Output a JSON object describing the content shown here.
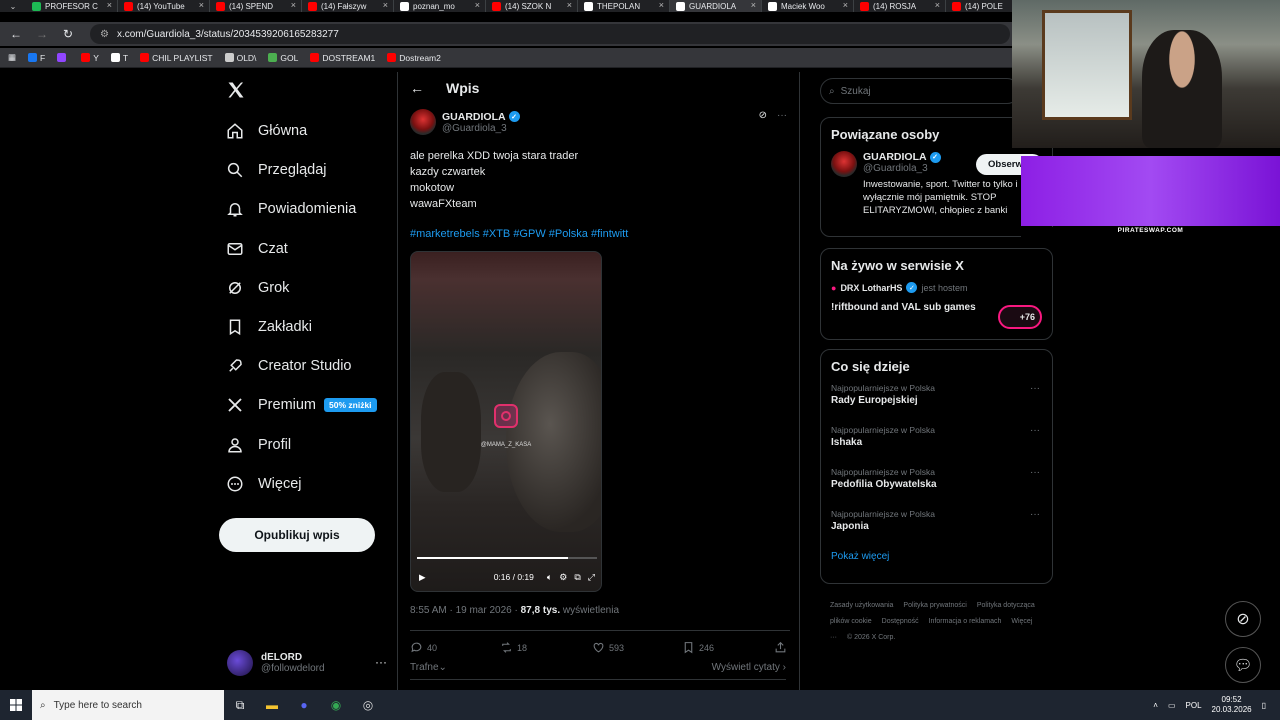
{
  "browser": {
    "tabs": [
      {
        "label": "PROFESOR C",
        "color": "#1db954"
      },
      {
        "label": "(14) YouTube",
        "color": "#ff0000"
      },
      {
        "label": "(14) SPEND",
        "color": "#ff0000"
      },
      {
        "label": "(14) Fałszyw",
        "color": "#ff0000"
      },
      {
        "label": "poznan_mo",
        "color": "#ffffff"
      },
      {
        "label": "(14) SZOK N",
        "color": "#ff0000"
      },
      {
        "label": "THEPOLAN",
        "color": "#ffffff"
      },
      {
        "label": "GUARDIOLA",
        "color": "#ffffff",
        "active": true
      },
      {
        "label": "Maciek Woo",
        "color": "#ffffff"
      },
      {
        "label": "(14) ROSJA",
        "color": "#ff0000"
      },
      {
        "label": "(14) POLE",
        "color": "#ff0000"
      }
    ],
    "url": "x.com/Guardiola_3/status/2034539206165283277",
    "bookmarks": [
      {
        "label": "F",
        "color": "#1877f2"
      },
      {
        "label": "",
        "color": "#9146ff"
      },
      {
        "label": "Y",
        "color": "#ff0000"
      },
      {
        "label": "T",
        "color": "#ffffff"
      },
      {
        "label": "CHIL PLAYLIST",
        "color": "#ff0000"
      },
      {
        "label": "OLD\\",
        "color": "#cccccc"
      },
      {
        "label": "GOL",
        "color": "#4caf50"
      },
      {
        "label": "DOSTREAM1",
        "color": "#ff0000"
      },
      {
        "label": "Dostream2",
        "color": "#ff0000"
      }
    ]
  },
  "nav": {
    "items": [
      {
        "label": "Główna",
        "icon": "home-icon"
      },
      {
        "label": "Przeglądaj",
        "icon": "search-icon"
      },
      {
        "label": "Powiadomienia",
        "icon": "bell-icon"
      },
      {
        "label": "Czat",
        "icon": "mail-icon"
      },
      {
        "label": "Grok",
        "icon": "grok-icon"
      },
      {
        "label": "Zakładki",
        "icon": "bookmark-icon"
      },
      {
        "label": "Creator Studio",
        "icon": "rocket-icon"
      },
      {
        "label": "Premium",
        "icon": "x-icon"
      },
      {
        "label": "Profil",
        "icon": "person-icon"
      },
      {
        "label": "Więcej",
        "icon": "more-circle-icon"
      }
    ],
    "premium_badge": "50% zniżki",
    "post_button": "Opublikuj wpis",
    "user": {
      "name": "dELORD",
      "handle": "@followdelord"
    }
  },
  "post": {
    "header": "Wpis",
    "author_name": "GUARDIOLA",
    "author_handle": "@Guardiola_3",
    "text_lines": [
      "ale perelka XDD twoja stara trader",
      "kazdy czwartek",
      "mokotow",
      "wawaFXteam"
    ],
    "hashtags": "#marketrebels #XTB #GPW #Polska #fintwitt",
    "video": {
      "watermark": "@MAMA_Z_KASA",
      "time": "0:16 / 0:19",
      "progress": 0.84
    },
    "timestamp": "8:55 AM · 19 mar 2026 · ",
    "views": "87,8 tys.",
    "views_label": "wyświetlenia",
    "replies": "40",
    "reposts": "18",
    "likes": "593",
    "bookmarks": "246",
    "sort": "Trafne",
    "quotes": "Wyświetl cytaty"
  },
  "sidebar": {
    "search_placeholder": "Szukaj",
    "related": {
      "title": "Powiązane osoby",
      "name": "GUARDIOLA",
      "handle": "@Guardiola_3",
      "follow": "Obserwuj",
      "bio": "Inwestowanie, sport. Twitter to tylko i wyłącznie mój pamiętnik. STOP ELITARYZMOWI, chłopiec z banki"
    },
    "live": {
      "title": "Na żywo w serwisie X",
      "host": "DRX LotharHS",
      "host_label": "jest hostem",
      "space": "!riftbound and VAL sub games",
      "count": "+76"
    },
    "trends": {
      "title": "Co się dzieje",
      "items": [
        {
          "category": "Najpopularniejsze w Polska",
          "name": "Rady Europejskiej"
        },
        {
          "category": "Najpopularniejsze w Polska",
          "name": "Ishaka"
        },
        {
          "category": "Najpopularniejsze w Polska",
          "name": "Pedofilia Obywatelska"
        },
        {
          "category": "Najpopularniejsze w Polska",
          "name": "Japonia"
        }
      ],
      "show_more": "Pokaż więcej"
    },
    "footer": [
      "Zasady użytkowania",
      "Polityka prywatności",
      "Polityka dotycząca plików cookie",
      "Dostępność",
      "Informacja o reklamach",
      "Więcej ···",
      "© 2026 X Corp."
    ]
  },
  "overlay": {
    "promo": "PIRATESWAP.COM"
  },
  "taskbar": {
    "search": "Type here to search",
    "lang": "POL",
    "time": "09:52",
    "date": "20.03.2026"
  }
}
